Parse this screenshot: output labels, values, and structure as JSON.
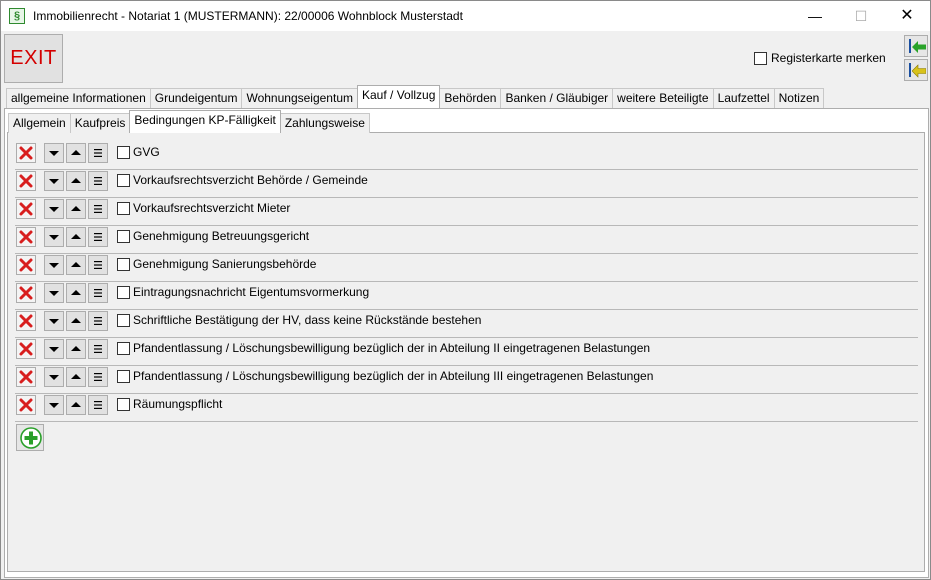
{
  "window": {
    "title": "Immobilienrecht - Notariat 1 (MUSTERMANN): 22/00006 Wohnblock Musterstadt",
    "app_icon": "§",
    "minimize": "—",
    "maximize": "☐",
    "close": "✕"
  },
  "toolbar": {
    "exit_label": "EXIT",
    "remember_tab_label": "Registerkarte merken",
    "remember_tab_checked": false
  },
  "main_tabs": [
    {
      "label": "allgemeine Informationen"
    },
    {
      "label": "Grundeigentum"
    },
    {
      "label": "Wohnungseigentum"
    },
    {
      "label": "Kauf / Vollzug"
    },
    {
      "label": "Behörden"
    },
    {
      "label": "Banken / Gläubiger"
    },
    {
      "label": "weitere Beteiligte"
    },
    {
      "label": "Laufzettel"
    },
    {
      "label": "Notizen"
    }
  ],
  "main_tabs_active": "Kauf / Vollzug",
  "sub_tabs": [
    {
      "label": "Allgemein"
    },
    {
      "label": "Kaufpreis"
    },
    {
      "label": "Bedingungen KP-Fälligkeit"
    },
    {
      "label": "Zahlungsweise"
    }
  ],
  "sub_tabs_active": "Bedingungen KP-Fälligkeit",
  "conditions": [
    {
      "label": "GVG",
      "checked": false
    },
    {
      "label": "Vorkaufsrechtsverzicht Behörde / Gemeinde",
      "checked": false
    },
    {
      "label": "Vorkaufsrechtsverzicht Mieter",
      "checked": false
    },
    {
      "label": "Genehmigung Betreuungsgericht",
      "checked": false
    },
    {
      "label": "Genehmigung Sanierungsbehörde",
      "checked": false
    },
    {
      "label": "Eintragungsnachricht Eigentumsvormerkung",
      "checked": false
    },
    {
      "label": "Schriftliche Bestätigung der HV, dass keine Rückstände bestehen",
      "checked": false
    },
    {
      "label": "Pfandentlassung / Löschungsbewilligung bezüglich der in Abteilung II eingetragenen Belastungen",
      "checked": false
    },
    {
      "label": "Pfandentlassung / Löschungsbewilligung bezüglich der in Abteilung III eingetragenen Belastungen",
      "checked": false
    },
    {
      "label": "Räumungspflicht",
      "checked": false
    }
  ],
  "icons": {
    "delete": "delete-x-icon",
    "move_down": "arrow-down-icon",
    "move_up": "arrow-up-icon",
    "menu": "menu-lines-icon",
    "add": "add-plus-icon",
    "nav_first": "nav-first-arrow-icon",
    "nav_prev": "nav-prev-arrow-icon"
  },
  "colors": {
    "exit_text": "#d40000",
    "delete_red": "#d81e1e",
    "add_green": "#2aa02a",
    "nav_arrow_green": "#29a329",
    "nav_arrow_yellow": "#d8c21a"
  }
}
